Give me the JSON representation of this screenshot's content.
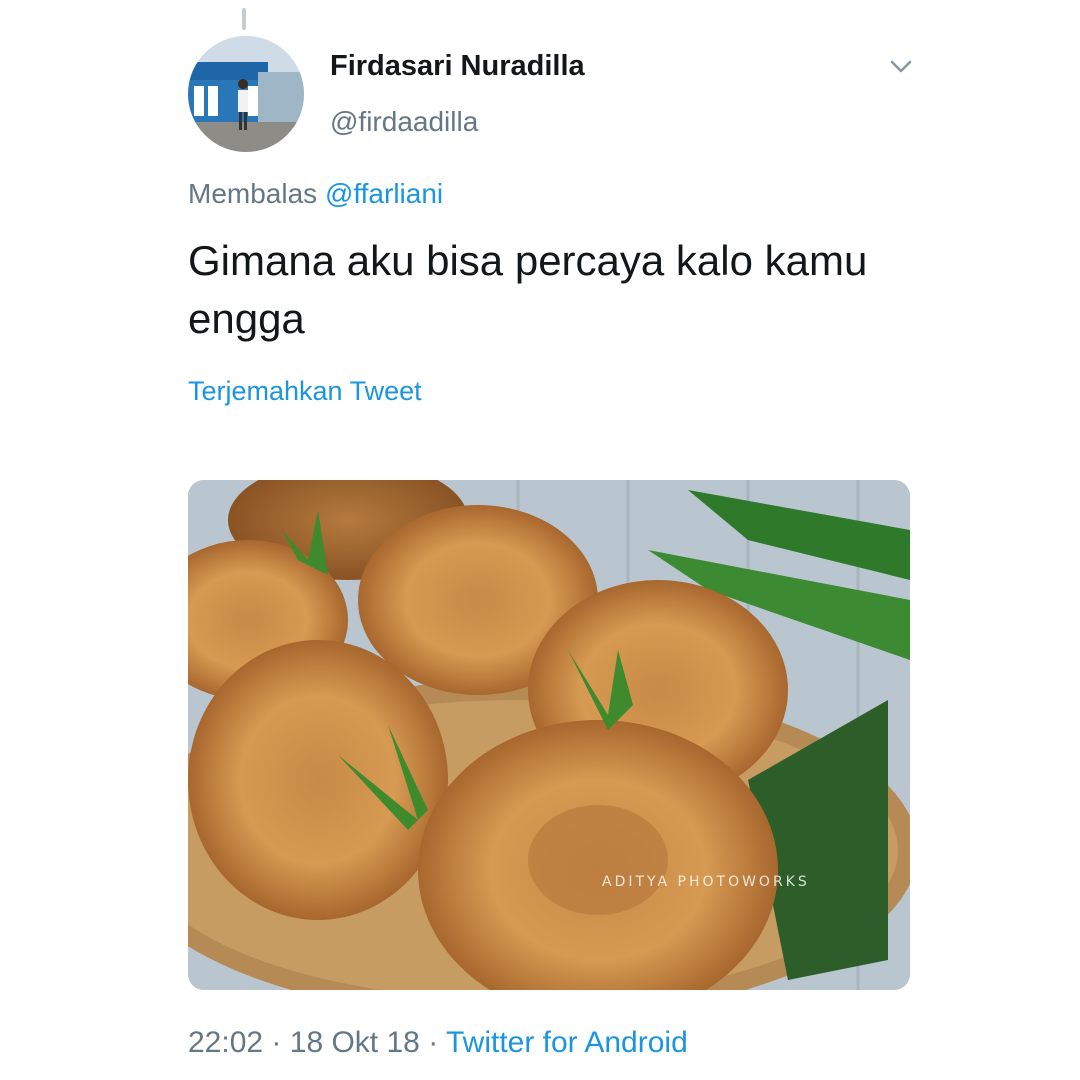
{
  "tweet": {
    "author": {
      "display_name": "Firdasari Nuradilla",
      "handle": "@firdaadilla",
      "avatar_icon": "profile-photo"
    },
    "reply_prefix": "Membalas",
    "reply_to": "@ffarliani",
    "text": "Gimana aku bisa percaya kalo kamu engga",
    "translate_label": "Terjemahkan Tweet",
    "media": {
      "watermark": "ADITYA PHOTOWORKS"
    },
    "time": "22:02",
    "date": "18 Okt 18",
    "source": "Twitter for Android",
    "separator": "·"
  },
  "colors": {
    "primary_text": "#14171a",
    "secondary_text": "#657786",
    "link": "#1b95e0"
  }
}
